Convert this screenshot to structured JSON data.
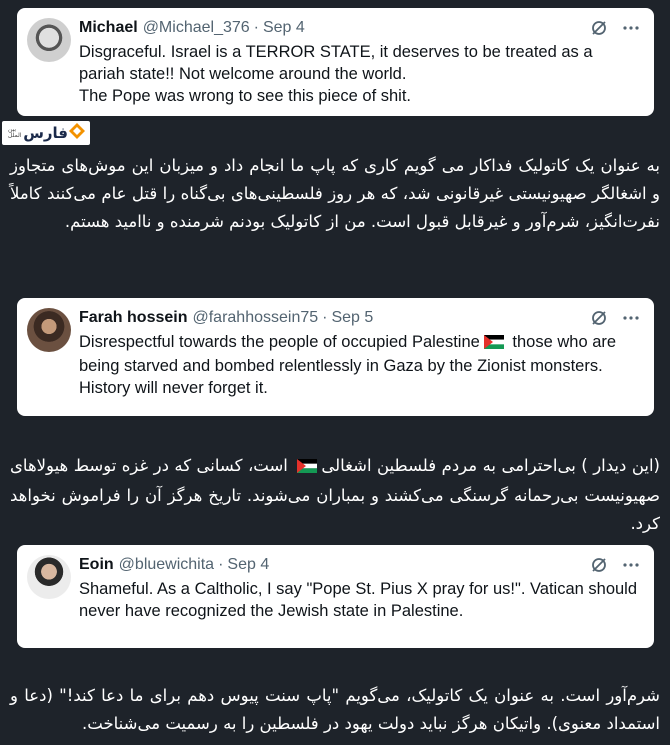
{
  "tweets": [
    {
      "name": "Michael",
      "handle": "@Michael_376",
      "sep": "·",
      "date": "Sep 4",
      "text": "Disgraceful. Israel is a TERROR STATE, it deserves to be treated as a pariah state!! Not welcome around the world.\nThe Pope was wrong to see this piece of shit."
    },
    {
      "name": "Farah hossein",
      "handle": "@farahhossein75",
      "sep": "·",
      "date": "Sep 5",
      "text_before_flag": "Disrespectful towards the people of occupied Palestine",
      "text_after_flag": " those who are being starved and bombed relentlessly in  Gaza by the Zionist monsters. History will never forget it."
    },
    {
      "name": "Eoin",
      "handle": "@bluewichita",
      "sep": "·",
      "date": "Sep 4",
      "text": "Shameful. As a Caltholic, I say \"Pope St. Pius X pray for us!\". Vatican should never have recognized the Jewish state in Palestine."
    }
  ],
  "logo": {
    "name": "فارس",
    "subtitle": "بین الملل",
    "colors": {
      "orange": "#f39200",
      "navy": "#1b2a4a"
    }
  },
  "translations": [
    {
      "text": "به عنوان یک کاتولیک فداکار می گویم کاری که پاپ ما انجام داد و میزبان این موش‌های متجاوز و اشغالگر صهیونیستی غیرقانونی شد، که هر روز فلسطینی‌های بی‌گناه را قتل عام می‌کنند  کاملاً نفرت‌انگیز، شرم‌آور و غیرقابل قبول است. من از کاتولیک بودنم شرمنده و ناامید هستم."
    },
    {
      "text_before_flag": "(این دیدار ) بی‌احترامی به مردم فلسطین اشغالی",
      "text_after_flag": " است، کسانی که در غزه توسط هیولاهای صهیونیست بی‌رحمانه گرسنگی می‌کشند و بمباران می‌شوند. تاریخ هرگز آن را فراموش نخواهد کرد."
    },
    {
      "text": "شرم‌آور است. به عنوان یک کاتولیک، می‌گویم \"پاپ سنت پیوس دهم برای ما دعا کند!\" (دعا و استمداد معنوی). واتیکان هرگز نباید دولت یهود در فلسطین را به رسمیت می‌شناخت."
    }
  ],
  "icons": {
    "grok": "grok-icon",
    "more": "more-icon",
    "flag": "palestine-flag-icon"
  },
  "colors": {
    "background": "#1e232a",
    "card": "#ffffff",
    "name_text": "#0f1419",
    "secondary_text": "#536471",
    "persian_text": "#ffffff"
  }
}
